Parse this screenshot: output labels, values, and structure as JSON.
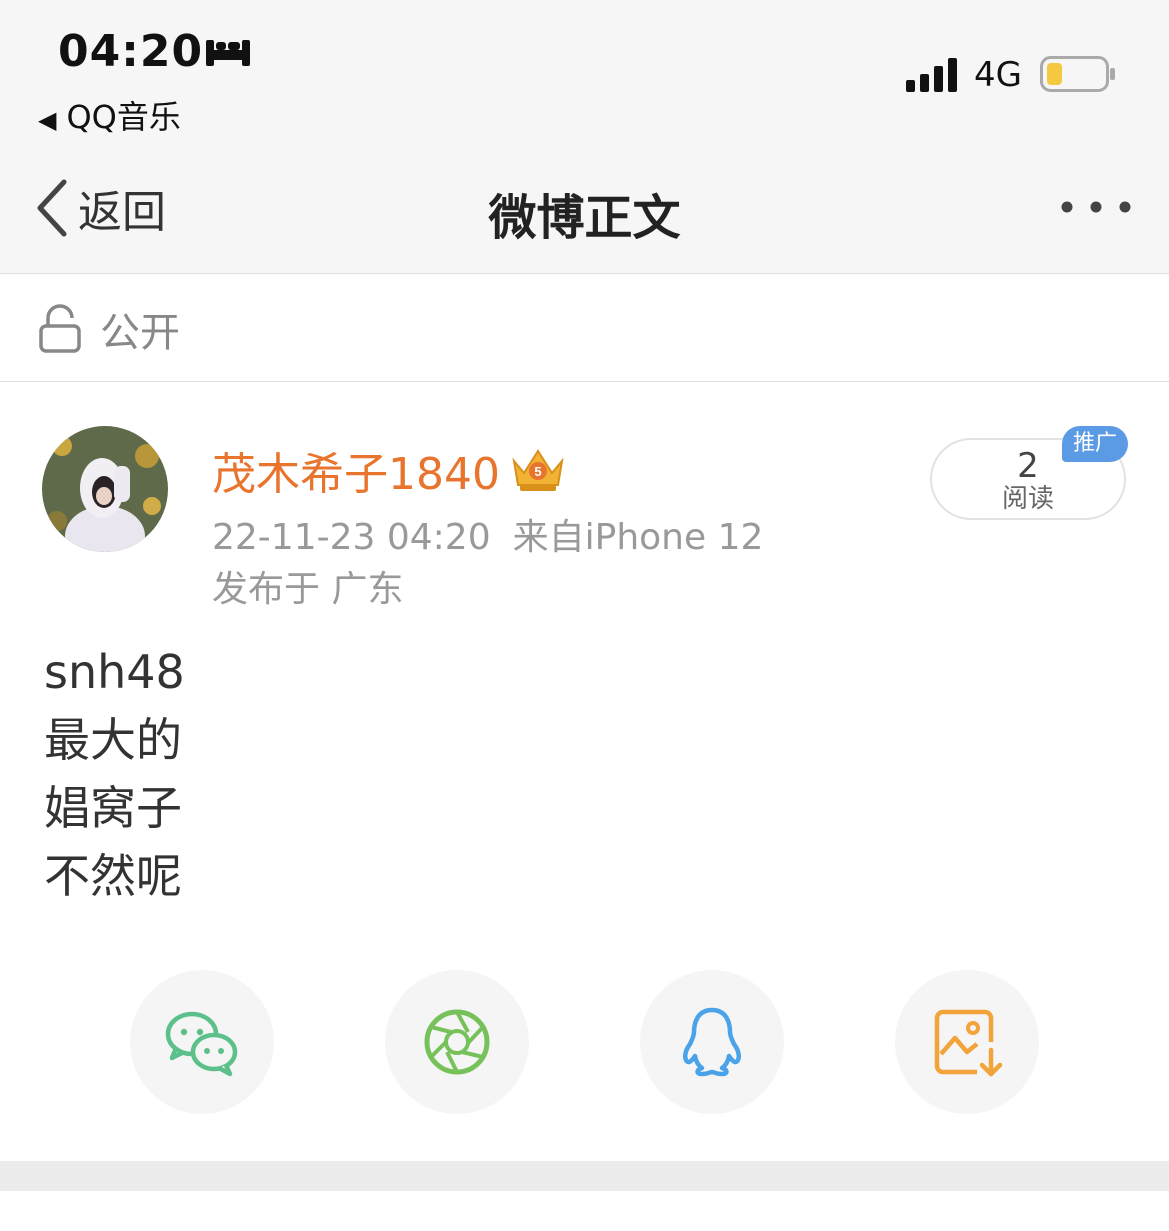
{
  "status_bar": {
    "time": "04:20",
    "back_app": "QQ音乐",
    "network": "4G",
    "icons": [
      "bed-icon",
      "signal-icon",
      "battery-icon"
    ],
    "battery_color": "#f5c842"
  },
  "nav": {
    "back_label": "返回",
    "title": "微博正文",
    "more_icon": "more-icon"
  },
  "visibility": {
    "label": "公开",
    "icon": "unlock-icon"
  },
  "post": {
    "author": "茂木希子1840",
    "badge_icon": "vip-crown-icon",
    "date": "22-11-23 04:20",
    "source": "来自iPhone 12",
    "location": "发布于 广东",
    "read_count": "2",
    "read_label": "阅读",
    "promo_label": "推广",
    "lines": [
      "snh48",
      "最大的",
      "娼窝子",
      "不然呢"
    ]
  },
  "share": [
    {
      "icon": "wechat-icon",
      "color": "#5cc08a"
    },
    {
      "icon": "moments-icon",
      "color": "#77c15a"
    },
    {
      "icon": "qq-icon",
      "color": "#4aa3e8"
    },
    {
      "icon": "save-image-icon",
      "color": "#f2a33a"
    }
  ],
  "colors": {
    "username": "#e8742d",
    "promo_bg": "#5b9be6",
    "meta_text": "#999999"
  }
}
